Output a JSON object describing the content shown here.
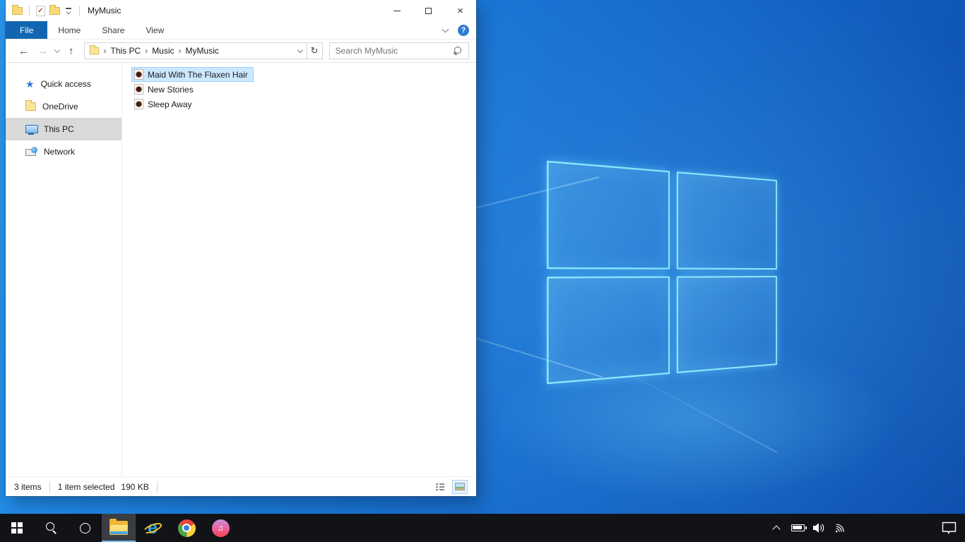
{
  "explorer": {
    "title": "MyMusic",
    "qat": {
      "app_icon": "folder-icon",
      "properties_icon": "properties-check-icon",
      "new_folder_icon": "new-folder-icon",
      "customize_icon": "customize-qat-dropdown-icon"
    },
    "ribbon": {
      "tabs": [
        {
          "label": "File",
          "active": true
        },
        {
          "label": "Home",
          "active": false
        },
        {
          "label": "Share",
          "active": false
        },
        {
          "label": "View",
          "active": false
        }
      ]
    },
    "navigation": {
      "breadcrumb": {
        "segments": [
          "This PC",
          "Music",
          "MyMusic"
        ]
      },
      "separator": "›",
      "search_placeholder": "Search MyMusic"
    },
    "sidebar": {
      "items": [
        {
          "label": "Quick access",
          "icon": "quick-access-star-icon",
          "selected": false
        },
        {
          "label": "OneDrive",
          "icon": "onedrive-folder-icon",
          "selected": false
        },
        {
          "label": "This PC",
          "icon": "this-pc-monitor-icon",
          "selected": true
        },
        {
          "label": "Network",
          "icon": "network-icon",
          "selected": false
        }
      ]
    },
    "files": [
      {
        "name": "Maid With The Flaxen Hair",
        "icon": "audio-file-icon",
        "selected": true
      },
      {
        "name": "New Stories",
        "icon": "audio-file-icon",
        "selected": false
      },
      {
        "name": "Sleep Away",
        "icon": "audio-file-icon",
        "selected": false
      }
    ],
    "status": {
      "count": "3 items",
      "selection": "1 item selected",
      "size": "190 KB"
    }
  },
  "glyphs": {
    "back": "←",
    "forward": "→",
    "up": "↑",
    "refresh": "↻",
    "help": "?",
    "close": "×",
    "check": "✓",
    "star": "★",
    "note": "♫",
    "ie_e": "e"
  },
  "taskbar": {
    "buttons": [
      {
        "name": "start",
        "active": false
      },
      {
        "name": "search",
        "active": false
      },
      {
        "name": "cortana",
        "active": false
      },
      {
        "name": "file-explorer",
        "active": true
      },
      {
        "name": "internet-explorer",
        "active": false
      },
      {
        "name": "chrome",
        "active": false
      },
      {
        "name": "itunes",
        "active": false
      }
    ],
    "tray": [
      "hidden-icons-chevron",
      "battery",
      "volume",
      "wifi"
    ],
    "action_center": "action-center"
  },
  "colors": {
    "file_tab_blue": "#1266b1",
    "selection_bg": "#cce8ff",
    "selection_border": "#99d1ff",
    "sidebar_selected": "#d9d9d9",
    "taskbar_bg": "#121316",
    "wallpaper_light": "#2a9af0",
    "wallpaper_dark": "#0e4fae",
    "logo_stroke": "#96f0ff"
  }
}
